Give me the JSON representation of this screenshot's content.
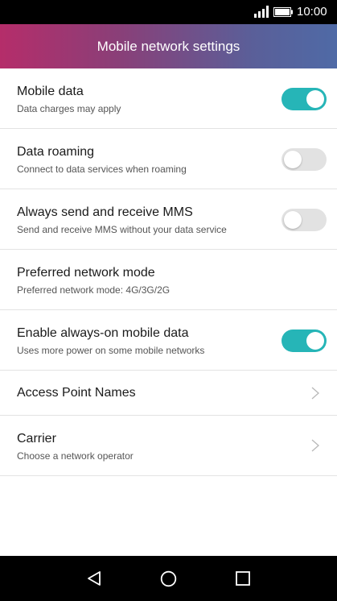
{
  "status_bar": {
    "time": "10:00"
  },
  "header": {
    "title": "Mobile network settings"
  },
  "settings": [
    {
      "title": "Mobile data",
      "subtitle": "Data charges may apply",
      "control": "toggle",
      "enabled": true
    },
    {
      "title": "Data roaming",
      "subtitle": "Connect to data services when roaming",
      "control": "toggle",
      "enabled": false
    },
    {
      "title": "Always send and receive MMS",
      "subtitle": "Send and receive MMS without your data service",
      "control": "toggle",
      "enabled": false
    },
    {
      "title": "Preferred network mode",
      "subtitle": "Preferred network mode: 4G/3G/2G",
      "control": "none"
    },
    {
      "title": "Enable always-on mobile data",
      "subtitle": "Uses more power on some mobile networks",
      "control": "toggle",
      "enabled": true
    },
    {
      "title": "Access Point Names",
      "subtitle": "",
      "control": "chevron"
    },
    {
      "title": "Carrier",
      "subtitle": "Choose a network operator",
      "control": "chevron"
    }
  ],
  "colors": {
    "accent": "#26b5b7",
    "toggle_off": "#e2e2e2",
    "header_start": "#b52d6a",
    "header_end": "#4f6aa6"
  },
  "icons": {
    "status": [
      "signal-icon",
      "battery-icon"
    ],
    "navigation": [
      "back-icon",
      "home-icon",
      "recents-icon"
    ],
    "row_action": "chevron-right-icon"
  }
}
